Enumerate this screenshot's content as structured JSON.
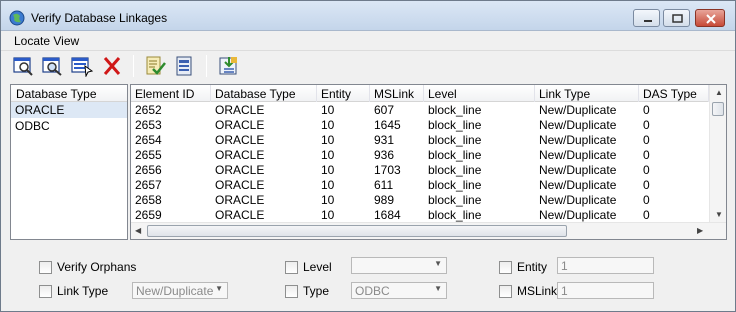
{
  "window": {
    "title": "Verify Database Linkages"
  },
  "menu": {
    "items": [
      "Locate View"
    ]
  },
  "toolbar": {
    "buttons": [
      {
        "icon": "locate-element-icon"
      },
      {
        "icon": "zoom-element-icon"
      },
      {
        "icon": "select-element-icon"
      },
      {
        "icon": "delete-linkage-icon",
        "color": "#d01818"
      },
      {
        "icon": "verify-checklist-icon",
        "color": "#2e8b2e"
      },
      {
        "icon": "report-icon"
      },
      {
        "icon": "export-icon"
      }
    ]
  },
  "database_types": {
    "header": "Database Type",
    "items": [
      "ORACLE",
      "ODBC"
    ],
    "selected": "ORACLE"
  },
  "grid": {
    "columns": [
      "Element ID",
      "Database Type",
      "Entity",
      "MSLink",
      "Level",
      "Link Type",
      "DAS Type"
    ],
    "rows": [
      [
        "2652",
        "ORACLE",
        "10",
        "607",
        "block_line",
        "New/Duplicate",
        "0"
      ],
      [
        "2653",
        "ORACLE",
        "10",
        "1645",
        "block_line",
        "New/Duplicate",
        "0"
      ],
      [
        "2654",
        "ORACLE",
        "10",
        "931",
        "block_line",
        "New/Duplicate",
        "0"
      ],
      [
        "2655",
        "ORACLE",
        "10",
        "936",
        "block_line",
        "New/Duplicate",
        "0"
      ],
      [
        "2656",
        "ORACLE",
        "10",
        "1703",
        "block_line",
        "New/Duplicate",
        "0"
      ],
      [
        "2657",
        "ORACLE",
        "10",
        "611",
        "block_line",
        "New/Duplicate",
        "0"
      ],
      [
        "2658",
        "ORACLE",
        "10",
        "989",
        "block_line",
        "New/Duplicate",
        "0"
      ],
      [
        "2659",
        "ORACLE",
        "10",
        "1684",
        "block_line",
        "New/Duplicate",
        "0"
      ]
    ]
  },
  "options": {
    "verify_orphans": {
      "label": "Verify Orphans",
      "checked": false
    },
    "link_type": {
      "label": "Link Type",
      "checked": false,
      "value": "New/Duplicate"
    },
    "level": {
      "label": "Level",
      "checked": false,
      "value": ""
    },
    "type": {
      "label": "Type",
      "checked": false,
      "value": "ODBC"
    },
    "entity": {
      "label": "Entity",
      "checked": false,
      "value": "1"
    },
    "mslink": {
      "label": "MSLink",
      "checked": false,
      "value": "1"
    }
  },
  "colors": {
    "selection": "#dde8f5",
    "titlebar": "#c4d5ea",
    "close_button": "#c74a38"
  }
}
